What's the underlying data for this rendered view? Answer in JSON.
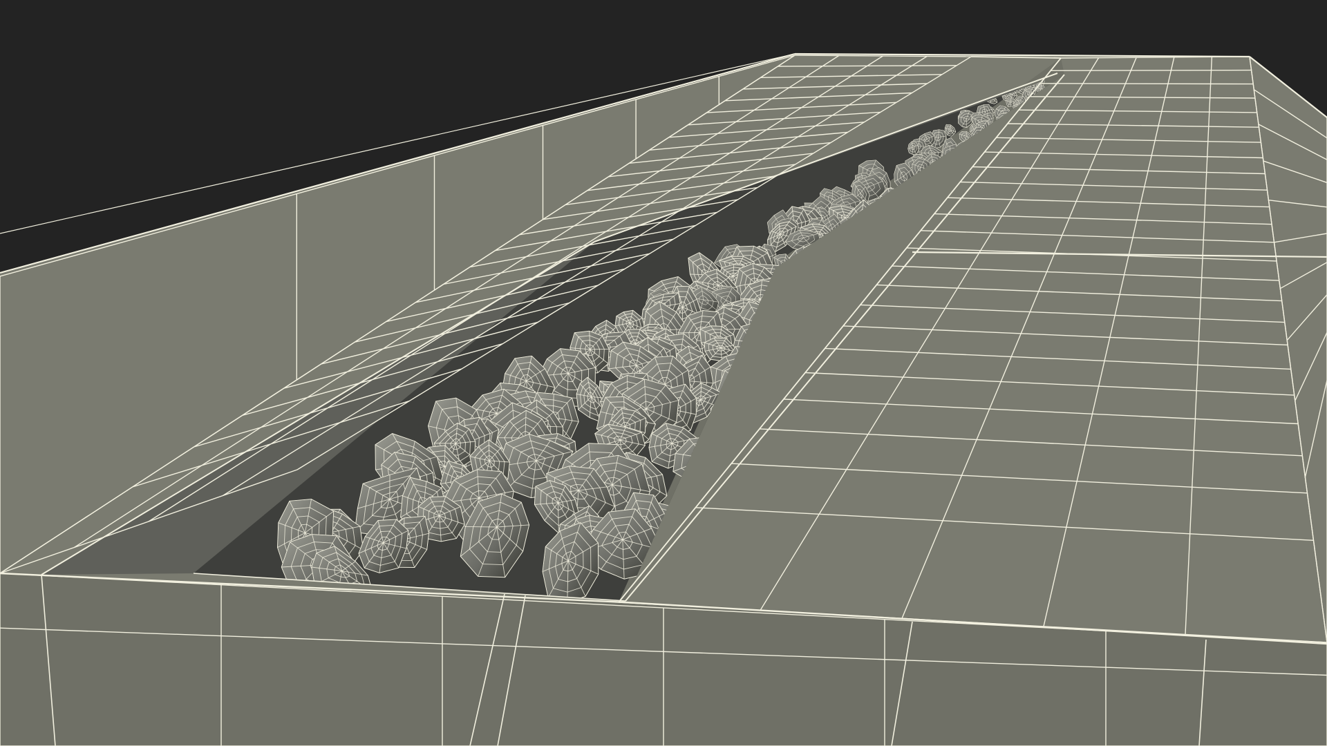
{
  "scene": {
    "subject": "wireframe-render",
    "colors": {
      "background": "#232323",
      "floor": "#7a7b70",
      "floor_shade": "#6f7066",
      "trench_wall": "#5f605a",
      "trench_floor": "#3e3f3c",
      "rock_light": "#8b8c84",
      "rock_mid": "#6a6b66",
      "rock_dark": "#3a3b38",
      "wire": "#f2f0df"
    }
  }
}
